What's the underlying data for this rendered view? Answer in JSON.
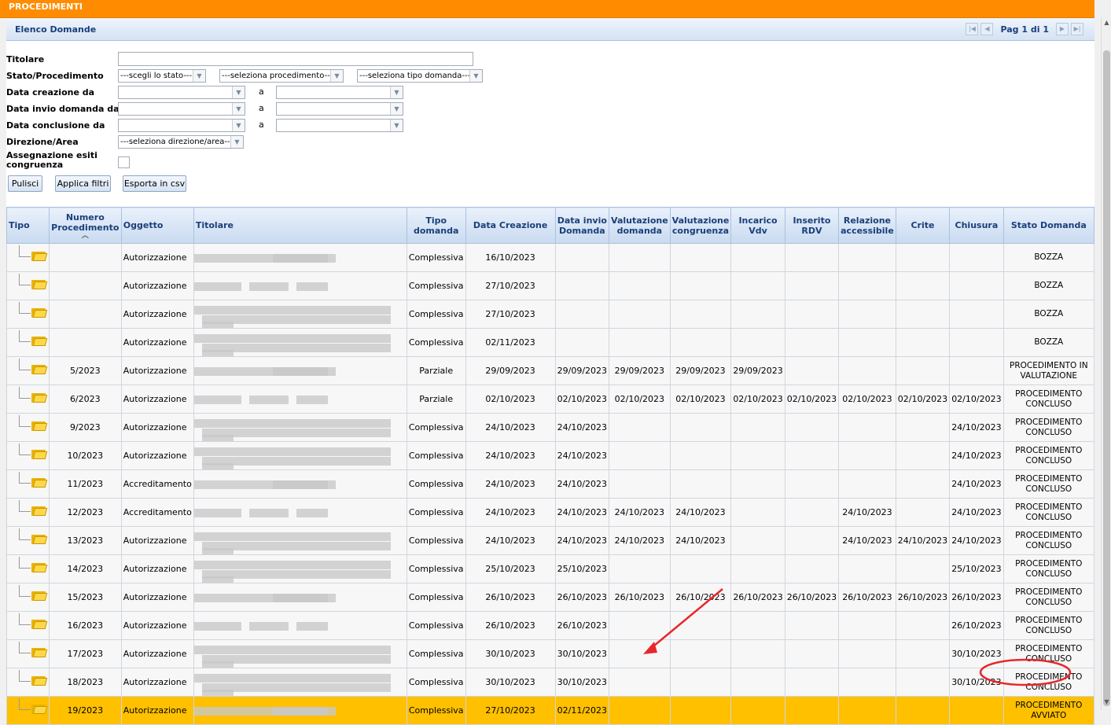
{
  "app": {
    "section_title": "PROCEDIMENTI"
  },
  "panel": {
    "title": "Elenco Domande",
    "pager": {
      "text": "Pag 1 di 1"
    }
  },
  "filters": {
    "titolare": "Titolare",
    "stato_procedimento": "Stato/Procedimento",
    "stato_select": "---scegli lo stato---",
    "procedimento_select": "---seleziona procedimento---",
    "tipo_domanda_select": "---seleziona tipo domanda---",
    "data_creazione": "Data creazione da",
    "data_invio": "Data invio domanda da",
    "data_conclusione": "Data conclusione da",
    "a": "a",
    "direzione_area": "Direzione/Area",
    "direzione_select": "---seleziona direzione/area---",
    "assegnazione_line1": "Assegnazione esiti",
    "assegnazione_line2": "congruenza"
  },
  "buttons": {
    "pulisci": "Pulisci",
    "applica": "Applica filtri",
    "esporta": "Esporta in csv"
  },
  "table": {
    "headers": [
      "Tipo",
      "Numero Procedimento",
      "Oggetto",
      "Titolare",
      "Tipo domanda",
      "Data Creazione",
      "Data invio Domanda",
      "Valutazione domanda",
      "Valutazione congruenza",
      "Incarico Vdv",
      "Inserito RDV",
      "Relazione accessibile",
      "Crite",
      "Chiusura",
      "Stato Domanda"
    ],
    "rows": [
      {
        "num": "",
        "oggetto": "Autorizzazione",
        "tipo": "Complessiva",
        "creazione": "16/10/2023",
        "invio": "",
        "val_dom": "",
        "val_cong": "",
        "inc_vdv": "",
        "ins_rdv": "",
        "rel_acc": "",
        "crite": "",
        "chiusura": "",
        "stato": "BOZZA"
      },
      {
        "num": "",
        "oggetto": "Autorizzazione",
        "tipo": "Complessiva",
        "creazione": "27/10/2023",
        "invio": "",
        "val_dom": "",
        "val_cong": "",
        "inc_vdv": "",
        "ins_rdv": "",
        "rel_acc": "",
        "crite": "",
        "chiusura": "",
        "stato": "BOZZA"
      },
      {
        "num": "",
        "oggetto": "Autorizzazione",
        "tipo": "Complessiva",
        "creazione": "27/10/2023",
        "invio": "",
        "val_dom": "",
        "val_cong": "",
        "inc_vdv": "",
        "ins_rdv": "",
        "rel_acc": "",
        "crite": "",
        "chiusura": "",
        "stato": "BOZZA"
      },
      {
        "num": "",
        "oggetto": "Autorizzazione",
        "tipo": "Complessiva",
        "creazione": "02/11/2023",
        "invio": "",
        "val_dom": "",
        "val_cong": "",
        "inc_vdv": "",
        "ins_rdv": "",
        "rel_acc": "",
        "crite": "",
        "chiusura": "",
        "stato": "BOZZA"
      },
      {
        "num": "5/2023",
        "oggetto": "Autorizzazione",
        "tipo": "Parziale",
        "creazione": "29/09/2023",
        "invio": "29/09/2023",
        "val_dom": "29/09/2023",
        "val_cong": "29/09/2023",
        "inc_vdv": "29/09/2023",
        "ins_rdv": "",
        "rel_acc": "",
        "crite": "",
        "chiusura": "",
        "stato": "PROCEDIMENTO IN VALUTAZIONE"
      },
      {
        "num": "6/2023",
        "oggetto": "Autorizzazione",
        "tipo": "Parziale",
        "creazione": "02/10/2023",
        "invio": "02/10/2023",
        "val_dom": "02/10/2023",
        "val_cong": "02/10/2023",
        "inc_vdv": "02/10/2023",
        "ins_rdv": "02/10/2023",
        "rel_acc": "02/10/2023",
        "crite": "02/10/2023",
        "chiusura": "02/10/2023",
        "stato": "PROCEDIMENTO CONCLUSO"
      },
      {
        "num": "9/2023",
        "oggetto": "Autorizzazione",
        "tipo": "Complessiva",
        "creazione": "24/10/2023",
        "invio": "24/10/2023",
        "val_dom": "",
        "val_cong": "",
        "inc_vdv": "",
        "ins_rdv": "",
        "rel_acc": "",
        "crite": "",
        "chiusura": "24/10/2023",
        "stato": "PROCEDIMENTO CONCLUSO"
      },
      {
        "num": "10/2023",
        "oggetto": "Autorizzazione",
        "tipo": "Complessiva",
        "creazione": "24/10/2023",
        "invio": "24/10/2023",
        "val_dom": "",
        "val_cong": "",
        "inc_vdv": "",
        "ins_rdv": "",
        "rel_acc": "",
        "crite": "",
        "chiusura": "24/10/2023",
        "stato": "PROCEDIMENTO CONCLUSO"
      },
      {
        "num": "11/2023",
        "oggetto": "Accreditamento",
        "tipo": "Complessiva",
        "creazione": "24/10/2023",
        "invio": "24/10/2023",
        "val_dom": "",
        "val_cong": "",
        "inc_vdv": "",
        "ins_rdv": "",
        "rel_acc": "",
        "crite": "",
        "chiusura": "24/10/2023",
        "stato": "PROCEDIMENTO CONCLUSO"
      },
      {
        "num": "12/2023",
        "oggetto": "Accreditamento",
        "tipo": "Complessiva",
        "creazione": "24/10/2023",
        "invio": "24/10/2023",
        "val_dom": "24/10/2023",
        "val_cong": "24/10/2023",
        "inc_vdv": "",
        "ins_rdv": "",
        "rel_acc": "24/10/2023",
        "crite": "",
        "chiusura": "24/10/2023",
        "stato": "PROCEDIMENTO CONCLUSO"
      },
      {
        "num": "13/2023",
        "oggetto": "Autorizzazione",
        "tipo": "Complessiva",
        "creazione": "24/10/2023",
        "invio": "24/10/2023",
        "val_dom": "24/10/2023",
        "val_cong": "24/10/2023",
        "inc_vdv": "",
        "ins_rdv": "",
        "rel_acc": "24/10/2023",
        "crite": "24/10/2023",
        "chiusura": "24/10/2023",
        "stato": "PROCEDIMENTO CONCLUSO"
      },
      {
        "num": "14/2023",
        "oggetto": "Autorizzazione",
        "tipo": "Complessiva",
        "creazione": "25/10/2023",
        "invio": "25/10/2023",
        "val_dom": "",
        "val_cong": "",
        "inc_vdv": "",
        "ins_rdv": "",
        "rel_acc": "",
        "crite": "",
        "chiusura": "25/10/2023",
        "stato": "PROCEDIMENTO CONCLUSO"
      },
      {
        "num": "15/2023",
        "oggetto": "Autorizzazione",
        "tipo": "Complessiva",
        "creazione": "26/10/2023",
        "invio": "26/10/2023",
        "val_dom": "26/10/2023",
        "val_cong": "26/10/2023",
        "inc_vdv": "26/10/2023",
        "ins_rdv": "26/10/2023",
        "rel_acc": "26/10/2023",
        "crite": "26/10/2023",
        "chiusura": "26/10/2023",
        "stato": "PROCEDIMENTO CONCLUSO"
      },
      {
        "num": "16/2023",
        "oggetto": "Autorizzazione",
        "tipo": "Complessiva",
        "creazione": "26/10/2023",
        "invio": "26/10/2023",
        "val_dom": "",
        "val_cong": "",
        "inc_vdv": "",
        "ins_rdv": "",
        "rel_acc": "",
        "crite": "",
        "chiusura": "26/10/2023",
        "stato": "PROCEDIMENTO CONCLUSO"
      },
      {
        "num": "17/2023",
        "oggetto": "Autorizzazione",
        "tipo": "Complessiva",
        "creazione": "30/10/2023",
        "invio": "30/10/2023",
        "val_dom": "",
        "val_cong": "",
        "inc_vdv": "",
        "ins_rdv": "",
        "rel_acc": "",
        "crite": "",
        "chiusura": "30/10/2023",
        "stato": "PROCEDIMENTO CONCLUSO"
      },
      {
        "num": "18/2023",
        "oggetto": "Autorizzazione",
        "tipo": "Complessiva",
        "creazione": "30/10/2023",
        "invio": "30/10/2023",
        "val_dom": "",
        "val_cong": "",
        "inc_vdv": "",
        "ins_rdv": "",
        "rel_acc": "",
        "crite": "",
        "chiusura": "30/10/2023",
        "stato": "PROCEDIMENTO CONCLUSO"
      },
      {
        "num": "19/2023",
        "oggetto": "Autorizzazione",
        "tipo": "Complessiva",
        "creazione": "27/10/2023",
        "invio": "02/11/2023",
        "val_dom": "",
        "val_cong": "",
        "inc_vdv": "",
        "ins_rdv": "",
        "rel_acc": "",
        "crite": "",
        "chiusura": "",
        "stato": "PROCEDIMENTO AVVIATO",
        "highlighted": true
      }
    ]
  },
  "annotation_colors": {
    "arrow": "#e8262b",
    "ellipse": "#e8262b",
    "highlight_row": "#ffc000"
  },
  "icons": {
    "row_icon": "folder-icon",
    "sort": "sort-ascending-icon"
  }
}
